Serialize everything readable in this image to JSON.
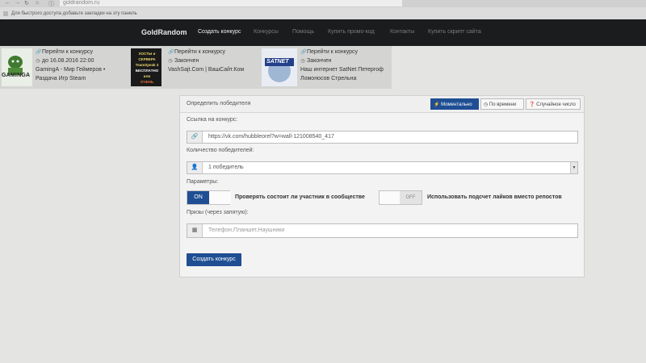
{
  "browser": {
    "url": "goldrandom.ru",
    "bookmarks_hint": "Для быстрого доступа добавьте закладки на эту панель"
  },
  "navbar": {
    "brand": "GoldRandom",
    "items": [
      "Создать конкурс",
      "Конкурсы",
      "Помощь",
      "Купить промо-код",
      "Контакты",
      "Купить скрипт сайта"
    ]
  },
  "contests": [
    {
      "logo_text": "GAMINGA",
      "link": "Перейти к конкурсу",
      "status": "до 16.08.2016 22:00",
      "title_line1": "GamingA - Мир Геймеров •",
      "title_line2": "Раздача Игр Steam"
    },
    {
      "banner_lines": [
        "ХОСТЫ и СЕРВЕРА",
        "TeamSpeak 3",
        "БЕСПЛАТНО",
        "или",
        "ОЧЕНЬ ДЕШЕВО!"
      ],
      "link": "Перейти к конкурсу",
      "status": "Закончен",
      "title_line1": "VashSajt.Com | ВашСайт.Ком"
    },
    {
      "logo_text": "SATNET",
      "link": "Перейти к конкурсу",
      "status": "Закончен",
      "title_line1": "Наш интернет SatNet Петергоф",
      "title_line2": "Ломоносов Стрельна"
    }
  ],
  "form": {
    "title": "Определить победителя",
    "tabs": [
      "Моментально",
      "По времени",
      "Случайное число"
    ],
    "link_label": "Ссылка на конкурс:",
    "link_value": "https://vk.com/hubbleorel?w=wall-121008540_417",
    "winners_label": "Количество победителей:",
    "winners_value": "1 победитель",
    "params_label": "Параметры:",
    "toggle1_state": "ON",
    "toggle1_text": "Проверять состоит ли участник в сообществе",
    "toggle2_state": "OFF",
    "toggle2_text": "Использовать подсчет лайков вместо репостов",
    "prizes_label": "Призы (через запятую):",
    "prizes_placeholder": "Телефон,Планшет,Наушники",
    "submit": "Создать конкурс"
  },
  "colors": {
    "navbar": "#1b1c1e",
    "accent": "#1f4e93",
    "page_bg": "#e4e5e3"
  }
}
